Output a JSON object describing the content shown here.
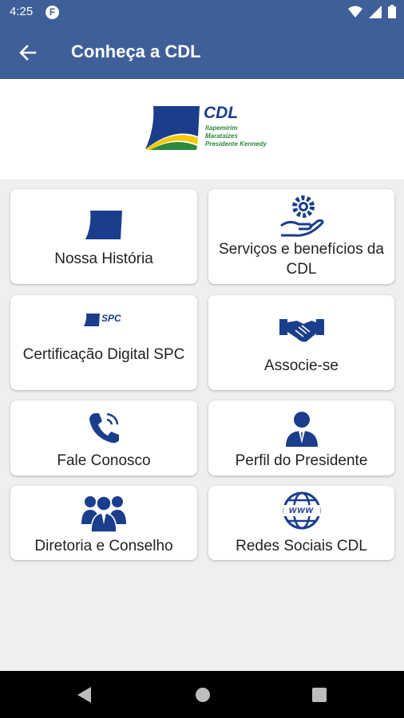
{
  "status_bar": {
    "time": "4:25",
    "notification_icon": "F"
  },
  "app_bar": {
    "title": "Conheça a CDL",
    "back_icon": "arrow-left-icon"
  },
  "logo": {
    "brand": "CDL",
    "lines": [
      "Itapemirim",
      "Marataízes",
      "Presidente Kennedy"
    ]
  },
  "menu": [
    {
      "label": "Nossa História",
      "icon": "book-icon"
    },
    {
      "label": "Serviços e benefícios da CDL",
      "icon": "gear-hand-icon"
    },
    {
      "label": "Certificação Digital SPC",
      "icon": "spc-logo-icon",
      "icon_text": "SPC"
    },
    {
      "label": "Associe-se",
      "icon": "handshake-icon"
    },
    {
      "label": "Fale Conosco",
      "icon": "phone-icon"
    },
    {
      "label": "Perfil do Presidente",
      "icon": "person-icon"
    },
    {
      "label": "Diretoria e Conselho",
      "icon": "group-icon"
    },
    {
      "label": "Redes Sociais CDL",
      "icon": "globe-icon",
      "icon_text": "www"
    }
  ],
  "colors": {
    "primary": "#3f5f98",
    "icon_blue": "#1a3e8c",
    "accent_yellow": "#f5c800",
    "accent_green": "#2e8a3e"
  }
}
